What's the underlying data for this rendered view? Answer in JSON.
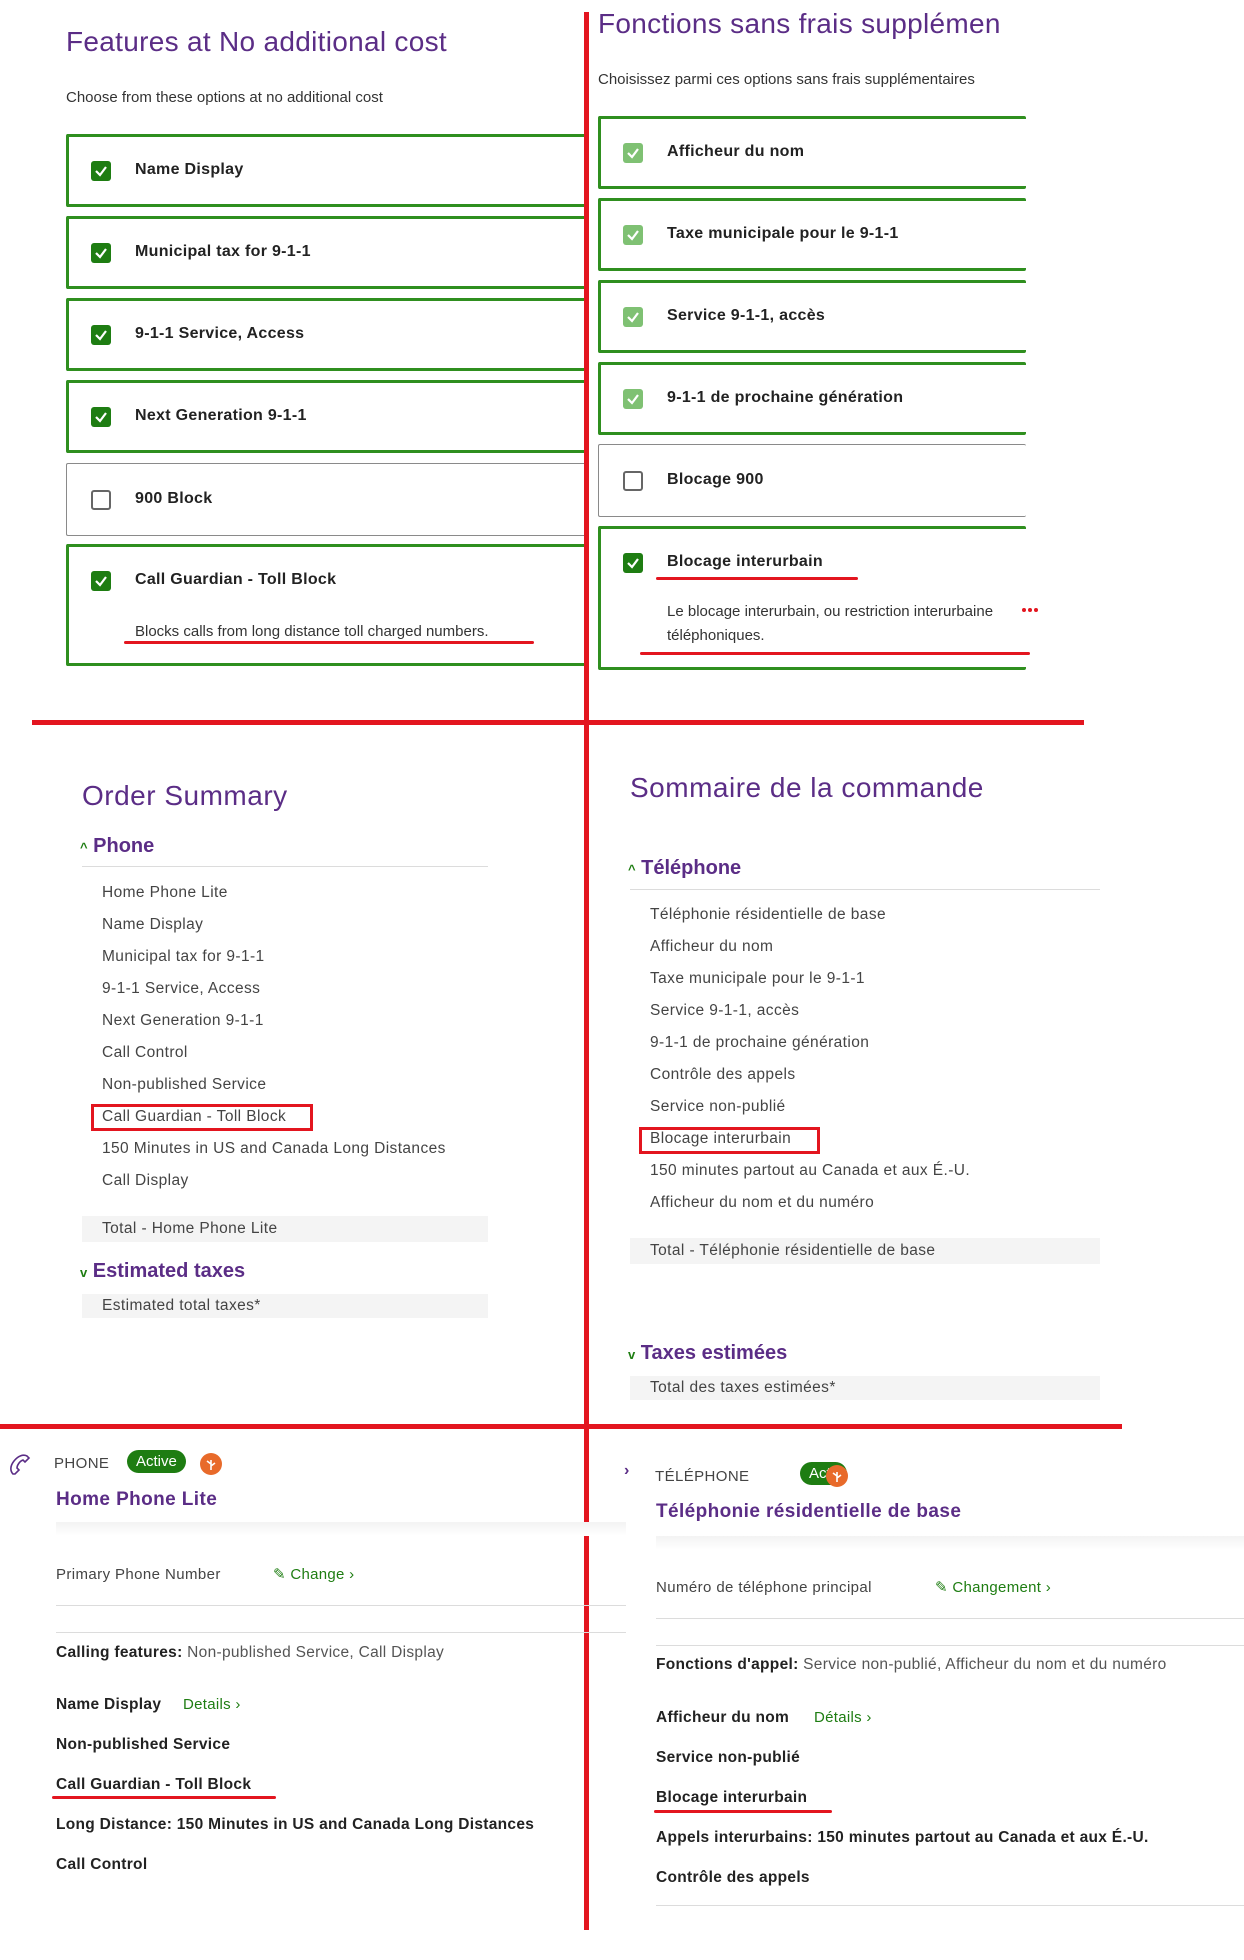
{
  "en_features": {
    "title": "Features at No additional cost",
    "subtitle": "Choose from these options at no additional cost",
    "options": [
      {
        "label": "Name Display",
        "checked": true
      },
      {
        "label": "Municipal tax for 9-1-1",
        "checked": true
      },
      {
        "label": "9-1-1 Service, Access",
        "checked": true
      },
      {
        "label": "Next Generation 9-1-1",
        "checked": true
      },
      {
        "label": "900 Block",
        "checked": false
      },
      {
        "label": "Call Guardian - Toll Block",
        "checked": true,
        "description": "Blocks calls from long distance toll charged numbers."
      }
    ]
  },
  "fr_features": {
    "title": "Fonctions sans frais supplémen",
    "subtitle": "Choisissez parmi ces options sans frais supplémentaires",
    "options": [
      {
        "label": "Afficheur du nom",
        "checked": true
      },
      {
        "label": "Taxe municipale pour le 9-1-1",
        "checked": true
      },
      {
        "label": "Service 9-1-1, accès",
        "checked": true
      },
      {
        "label": "9-1-1 de prochaine génération",
        "checked": true
      },
      {
        "label": "Blocage 900",
        "checked": false
      },
      {
        "label": "Blocage interurbain",
        "checked": true,
        "description_line1": "Le blocage interurbain, ou restriction interurbaine",
        "description_line2": "téléphoniques."
      }
    ]
  },
  "en_summary": {
    "title": "Order Summary",
    "phone_section": "Phone",
    "items": [
      "Home Phone Lite",
      "Name Display",
      "Municipal tax for 9-1-1",
      "9-1-1 Service, Access",
      "Next Generation 9-1-1",
      "Call Control",
      "Non-published Service",
      "Call Guardian - Toll Block",
      "150 Minutes in US and Canada Long Distances",
      "Call Display"
    ],
    "total": "Total - Home Phone Lite",
    "taxes_section": "Estimated taxes",
    "taxes_total": "Estimated total taxes*"
  },
  "fr_summary": {
    "title": "Sommaire de la commande",
    "phone_section": "Téléphone",
    "items": [
      "Téléphonie résidentielle de base",
      "Afficheur du nom",
      "Taxe municipale pour le 9-1-1",
      "Service 9-1-1, accès",
      "9-1-1 de prochaine génération",
      "Contrôle des appels",
      "Service non-publié",
      "Blocage interurbain",
      "150 minutes partout au Canada et aux É.-U.",
      "Afficheur du nom et du numéro"
    ],
    "total": "Total - Téléphonie résidentielle de base",
    "taxes_section": "Taxes estimées",
    "taxes_total": "Total des taxes estimées*"
  },
  "en_account": {
    "section": "PHONE",
    "status": "Active",
    "product": "Home Phone Lite",
    "primary_label": "Primary Phone Number",
    "change": "Change",
    "calling_label": "Calling features:",
    "calling_value": "Non-published Service, Call Display",
    "features": [
      "Name Display",
      "Non-published Service",
      "Call Guardian - Toll Block",
      "Call Control"
    ],
    "details": "Details",
    "long_distance_label": "Long Distance:",
    "long_distance_value": "150 Minutes in US and Canada Long Distances"
  },
  "fr_account": {
    "section": "TÉLÉPHONE",
    "status": "Actif",
    "product": "Téléphonie résidentielle de base",
    "primary_label": "Numéro de téléphone principal",
    "change": "Changement",
    "calling_label": "Fonctions d'appel:",
    "calling_value": "Service non-publié, Afficheur du nom et du numéro",
    "features": [
      "Afficheur du nom",
      "Service non-publié",
      "Blocage interurbain",
      "Contrôle des appels"
    ],
    "details": "Détails",
    "long_distance_label": "Appels interurbains:",
    "long_distance_value": "150 minutes partout au Canada et aux É.-U."
  },
  "colors": {
    "brand": "#5b2d86",
    "accent": "#1e7d12",
    "annotation": "#e3151f"
  },
  "icons": [
    "check-icon",
    "chevron-up-icon",
    "chevron-down-icon",
    "chevron-right-icon",
    "phone-icon",
    "leaf-icon",
    "pencil-icon"
  ]
}
